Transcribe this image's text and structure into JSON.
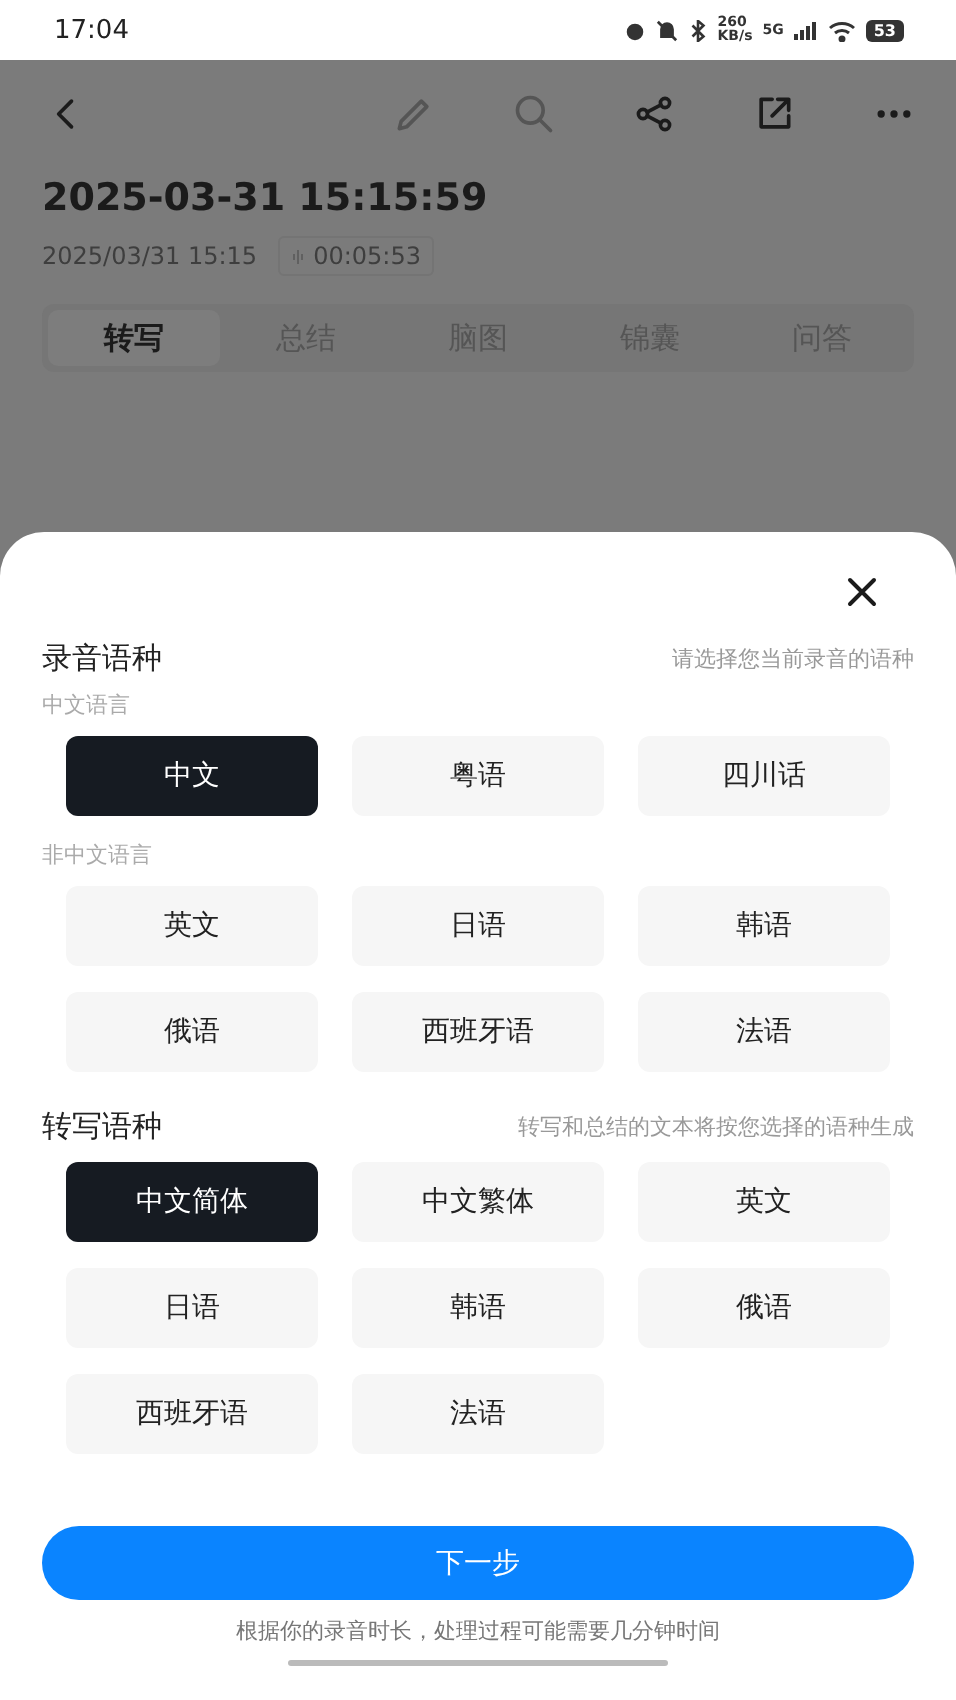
{
  "status_bar": {
    "time": "17:04",
    "speed": "260",
    "speed_unit": "KB/s",
    "network": "5G",
    "battery": "53"
  },
  "recording": {
    "title": "2025-03-31 15:15:59",
    "date": "2025/03/31 15:15",
    "duration": "00:05:53"
  },
  "tabs": [
    {
      "label": "转写",
      "selected": true
    },
    {
      "label": "总结",
      "selected": false
    },
    {
      "label": "脑图",
      "selected": false
    },
    {
      "label": "锦囊",
      "selected": false
    },
    {
      "label": "问答",
      "selected": false
    }
  ],
  "sheet": {
    "recording_language": {
      "title": "录音语种",
      "hint": "请选择您当前录音的语种",
      "groups": [
        {
          "label": "中文语言",
          "options": [
            {
              "label": "中文",
              "selected": true
            },
            {
              "label": "粤语",
              "selected": false
            },
            {
              "label": "四川话",
              "selected": false
            }
          ]
        },
        {
          "label": "非中文语言",
          "options": [
            {
              "label": "英文",
              "selected": false
            },
            {
              "label": "日语",
              "selected": false
            },
            {
              "label": "韩语",
              "selected": false
            },
            {
              "label": "俄语",
              "selected": false
            },
            {
              "label": "西班牙语",
              "selected": false
            },
            {
              "label": "法语",
              "selected": false
            }
          ]
        }
      ]
    },
    "transcript_language": {
      "title": "转写语种",
      "hint": "转写和总结的文本将按您选择的语种生成",
      "options": [
        {
          "label": "中文简体",
          "selected": true
        },
        {
          "label": "中文繁体",
          "selected": false
        },
        {
          "label": "英文",
          "selected": false
        },
        {
          "label": "日语",
          "selected": false
        },
        {
          "label": "韩语",
          "selected": false
        },
        {
          "label": "俄语",
          "selected": false
        },
        {
          "label": "西班牙语",
          "selected": false
        },
        {
          "label": "法语",
          "selected": false
        }
      ]
    },
    "next_button": "下一步",
    "footnote": "根据你的录音时长，处理过程可能需要几分钟时间"
  }
}
